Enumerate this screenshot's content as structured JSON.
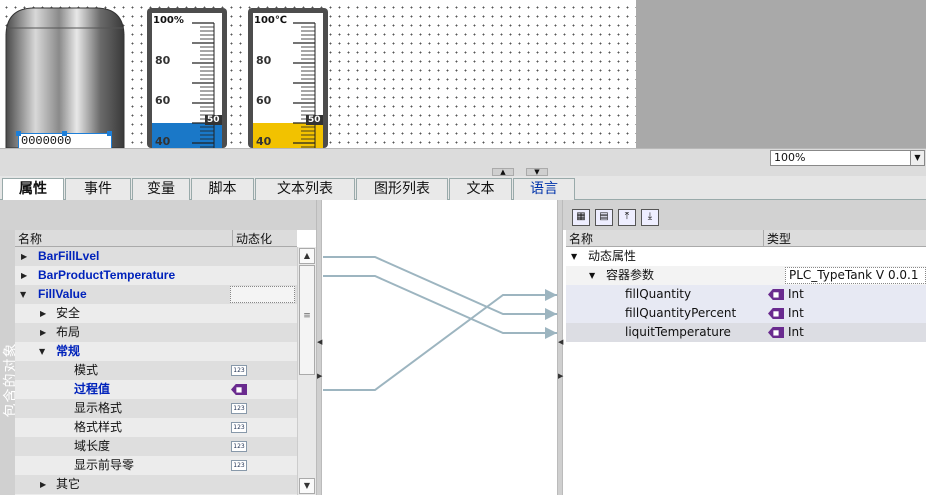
{
  "canvas": {
    "gauge1": {
      "top_label": "100%",
      "ticks": [
        "80",
        "60",
        "40"
      ],
      "value_label": "50",
      "fill_color": "#1a78c8",
      "level": 0.5
    },
    "gauge2": {
      "top_label": "100℃",
      "ticks": [
        "80",
        "60",
        "40"
      ],
      "value_label": "50",
      "fill_color": "#f2c200",
      "level": 0.5
    },
    "tank_io_field": "0000000"
  },
  "zoom": {
    "value": "100%"
  },
  "tabs": [
    {
      "label": "属性",
      "active": true
    },
    {
      "label": "事件"
    },
    {
      "label": "变量"
    },
    {
      "label": "脚本"
    },
    {
      "label": "文本列表"
    },
    {
      "label": "图形列表"
    },
    {
      "label": "文本"
    },
    {
      "label": "语言"
    }
  ],
  "left_panel": {
    "vertical_label": "包含的对象",
    "columns": {
      "name": "名称",
      "dynamic": "动态化"
    },
    "rows": [
      {
        "label": "BarFillLvel"
      },
      {
        "label": "BarProductTemperature"
      },
      {
        "label": "FillValue"
      },
      {
        "label": "安全"
      },
      {
        "label": "布局"
      },
      {
        "label": "常规"
      },
      {
        "label": "模式"
      },
      {
        "label": "过程值"
      },
      {
        "label": "显示格式"
      },
      {
        "label": "格式样式"
      },
      {
        "label": "域长度"
      },
      {
        "label": "显示前导零"
      },
      {
        "label": "其它"
      }
    ],
    "num_icon_text": "123"
  },
  "right_panel": {
    "columns": {
      "name": "名称",
      "type": "类型"
    },
    "rows": [
      {
        "label": "动态属性",
        "type": ""
      },
      {
        "label": "容器参数",
        "type": "PLC_TypeTank V 0.0.1"
      },
      {
        "label": "fillQuantity",
        "type": "Int"
      },
      {
        "label": "fillQuantityPercent",
        "type": "Int"
      },
      {
        "label": "liquitTemperature",
        "type": "Int"
      }
    ]
  },
  "colors": {
    "link_line": "#9db5c0",
    "selected_row": "#e7e9f3",
    "accent_blue": "#0022bb"
  }
}
